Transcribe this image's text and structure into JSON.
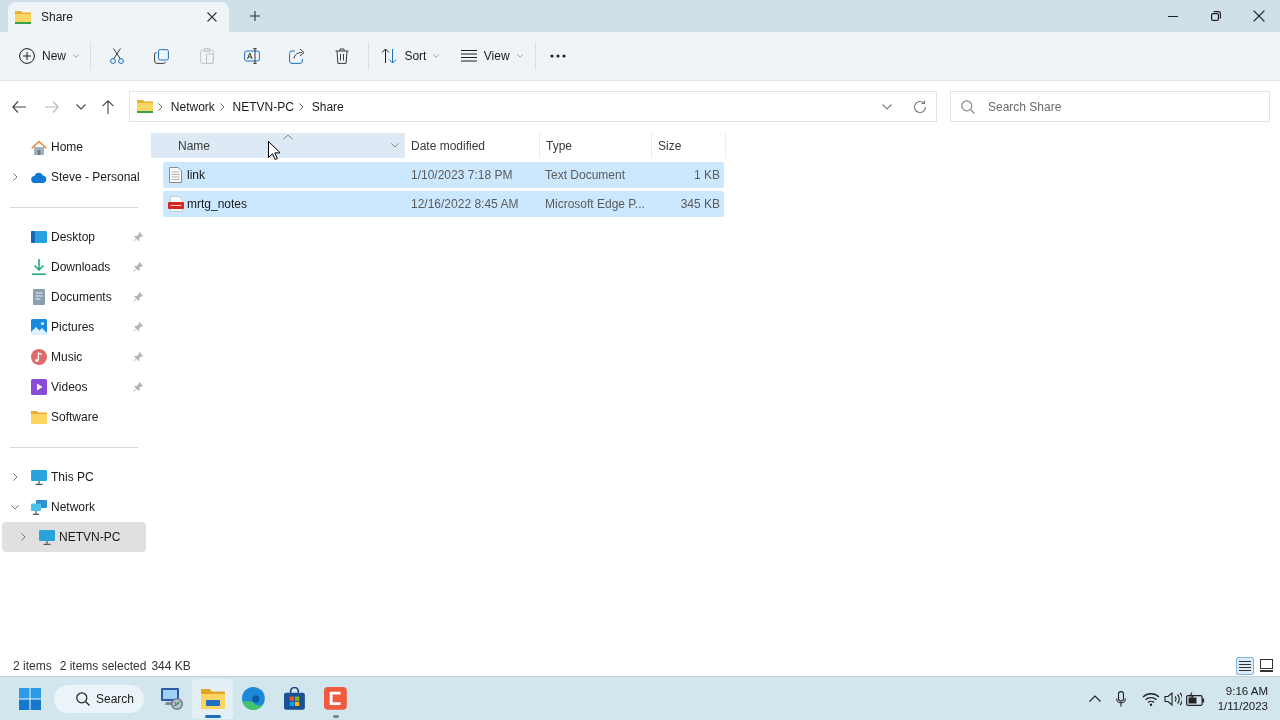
{
  "window": {
    "tabs": [
      {
        "title": "Share",
        "selected": true
      }
    ]
  },
  "toolbar": {
    "new_label": "New",
    "actions": [
      {
        "kind": "cut",
        "disabled": false
      },
      {
        "kind": "copy",
        "disabled": false
      },
      {
        "kind": "paste",
        "disabled": true
      },
      {
        "kind": "rename",
        "disabled": false
      },
      {
        "kind": "share",
        "disabled": false
      },
      {
        "kind": "delete",
        "disabled": false
      }
    ],
    "sort_label": "Sort",
    "view_label": "View"
  },
  "navigation": [
    {
      "kind": "back",
      "disabled": false
    },
    {
      "kind": "forward",
      "disabled": true
    },
    {
      "kind": "recent",
      "disabled": false
    },
    {
      "kind": "up",
      "disabled": false
    }
  ],
  "address_bar": {
    "path": [
      "Network",
      "NETVN-PC",
      "Share"
    ]
  },
  "search": {
    "placeholder": "Search Share"
  },
  "sidebar": {
    "groups": [
      {
        "items": [
          {
            "label": "Home",
            "kind": "home",
            "selected": false
          },
          {
            "label": "Steve - Personal",
            "kind": "cloud",
            "expanded": false,
            "selected": false
          }
        ]
      },
      {
        "items": [
          {
            "label": "Desktop",
            "kind": "desktop",
            "pinned": true,
            "selected": false
          },
          {
            "label": "Downloads",
            "kind": "downloads",
            "pinned": true,
            "selected": false
          },
          {
            "label": "Documents",
            "kind": "documents",
            "pinned": true,
            "selected": false
          },
          {
            "label": "Pictures",
            "kind": "pictures",
            "pinned": true,
            "selected": false
          },
          {
            "label": "Music",
            "kind": "music",
            "pinned": true,
            "selected": false
          },
          {
            "label": "Videos",
            "kind": "videos",
            "pinned": true,
            "selected": false
          },
          {
            "label": "Software",
            "kind": "folder",
            "pinned": false,
            "selected": false
          }
        ]
      },
      {
        "items": [
          {
            "label": "This PC",
            "kind": "pc",
            "expanded": false,
            "selected": false
          },
          {
            "label": "Network",
            "kind": "network",
            "expanded": true,
            "selected": false,
            "children": [
              {
                "label": "NETVN-PC",
                "kind": "pc",
                "expanded": false,
                "selected": true
              }
            ]
          }
        ]
      }
    ]
  },
  "file_list": {
    "columns": [
      {
        "label": "Name",
        "sorted": true
      },
      {
        "label": "Date modified",
        "sorted": false
      },
      {
        "label": "Type",
        "sorted": false
      },
      {
        "label": "Size",
        "sorted": false
      }
    ],
    "rows": [
      {
        "name": "link",
        "kind": "text",
        "date_modified": "1/10/2023 7:18 PM",
        "type": "Text Document",
        "size": "1 KB",
        "selected": true
      },
      {
        "name": "mrtg_notes",
        "kind": "pdf",
        "date_modified": "12/16/2022 8:45 AM",
        "type": "Microsoft Edge P...",
        "size": "345 KB",
        "selected": true
      }
    ]
  },
  "status_bar": {
    "item_count": "2 items",
    "selection": "2 items selected",
    "selection_size": "344 KB",
    "views": [
      {
        "kind": "details",
        "selected": true
      },
      {
        "kind": "tiles",
        "selected": false
      }
    ]
  },
  "taskbar": {
    "search_label": "Search",
    "apps": [
      {
        "kind": "remote-desktop",
        "running": false,
        "active": false
      },
      {
        "kind": "file-explorer",
        "running": true,
        "active": true
      },
      {
        "kind": "browser",
        "running": false,
        "active": false
      },
      {
        "kind": "store",
        "running": false,
        "active": false
      },
      {
        "kind": "recorder",
        "running": true,
        "active": false
      }
    ],
    "time": "9:16 AM",
    "date": "1/11/2023"
  }
}
